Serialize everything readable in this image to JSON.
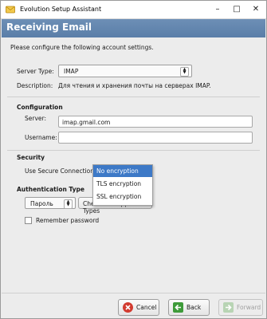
{
  "window": {
    "title": "Evolution Setup Assistant"
  },
  "banner": {
    "title": "Receiving Email"
  },
  "intro": "Please configure the following account settings.",
  "server_type": {
    "label": "Server Type:",
    "value": "IMAP"
  },
  "description": {
    "label": "Description:",
    "value": "Для чтения и хранения почты на серверах IMAP."
  },
  "configuration": {
    "heading": "Configuration",
    "server_label": "Server:",
    "server_value": "imap.gmail.com",
    "username_label": "Username:",
    "username_value": ""
  },
  "security": {
    "heading": "Security",
    "use_secure_label": "Use Secure Connection:",
    "options": [
      "No encryption",
      "TLS encryption",
      "SSL encryption"
    ],
    "selected_index": 0
  },
  "authentication": {
    "heading": "Authentication Type",
    "type_value": "Пароль",
    "check_button": "Check for Supported Types",
    "remember_label": "Remember password",
    "remember_checked": false
  },
  "footer": {
    "cancel": "Cancel",
    "back": "Back",
    "forward": "Forward"
  },
  "colors": {
    "banner": "#5a7ea8",
    "selection": "#3d79c7"
  }
}
